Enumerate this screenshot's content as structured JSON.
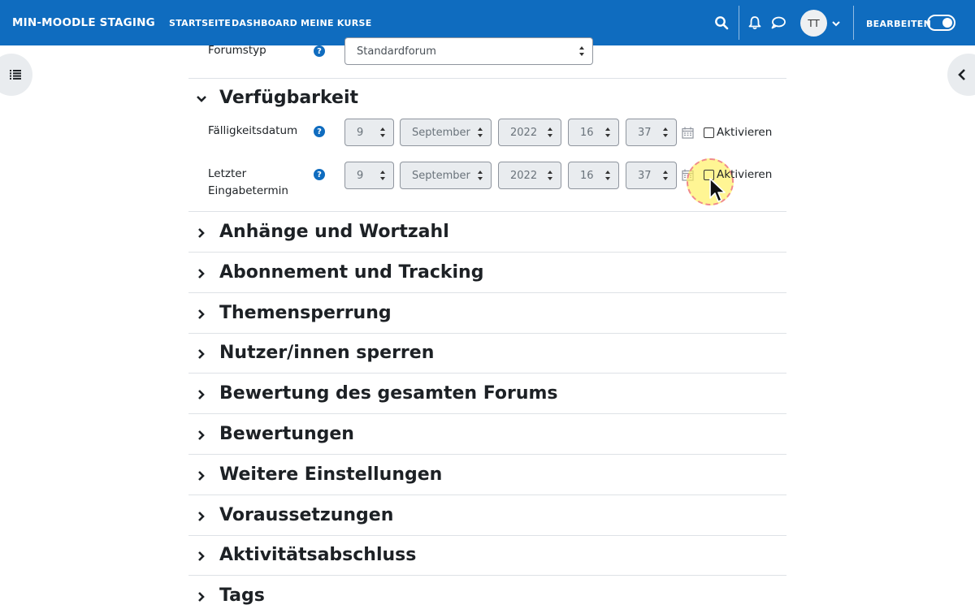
{
  "navbar": {
    "brand": "MIN-MOODLE STAGING",
    "links": [
      "STARTSEITE",
      "DASHBOARD",
      "MEINE KURSE"
    ],
    "avatar_initials": "TT",
    "edit_label": "BEARBEITEN",
    "edit_mode_on": true
  },
  "form": {
    "forum_type": {
      "label": "Forumstyp",
      "value": "Standardforum"
    },
    "availability": {
      "title": "Verfügbarkeit",
      "due_date": {
        "label": "Fälligkeitsdatum",
        "day": "9",
        "month": "September",
        "year": "2022",
        "hour": "16",
        "minute": "37",
        "enable_label": "Aktivieren"
      },
      "cutoff_date": {
        "label_line1": "Letzter",
        "label_line2": "Eingabetermin",
        "day": "9",
        "month": "September",
        "year": "2022",
        "hour": "16",
        "minute": "37",
        "enable_label": "Aktivieren"
      }
    },
    "sections": [
      "Anhänge und Wortzahl",
      "Abonnement und Tracking",
      "Themensperrung",
      "Nutzer/innen sperren",
      "Bewertung des gesamten Forums",
      "Bewertungen",
      "Weitere Einstellungen",
      "Voraussetzungen",
      "Aktivitätsabschluss",
      "Tags"
    ]
  },
  "colors": {
    "navbar": "#0f6cbf",
    "help_icon": "#0f6cbf",
    "highlight": "#fff05a"
  },
  "help_glyph": "?"
}
